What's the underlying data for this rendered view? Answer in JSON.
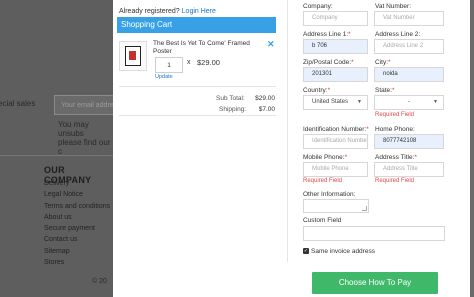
{
  "background": {
    "newsletter_placeholder": "Your email address",
    "special_sales": "ecial sales",
    "unsubscribe_line1": "You may unsubs",
    "unsubscribe_line2": "please find our c",
    "company_heading": "OUR COMPANY",
    "links": [
      "Delivery",
      "Legal Notice",
      "Terms and conditions",
      "About us",
      "Secure payment",
      "Contact us",
      "Sitemap",
      "Stores"
    ],
    "copyright": "© 20"
  },
  "cart": {
    "already_registered": "Already registered?",
    "login_link": "Login Here",
    "heading": "Shopping Cart",
    "item": {
      "name": "The Best Is Yet To Come' Framed Poster",
      "quantity": "1",
      "times": "x",
      "price": "$29.00",
      "update_label": "Update",
      "remove_icon": "close-icon"
    },
    "subtotal_label": "Sub Total:",
    "subtotal_value": "$29.00",
    "shipping_label": "Shipping:",
    "shipping_value": "$7.00"
  },
  "form": {
    "company": {
      "label": "Company:",
      "placeholder": "Company"
    },
    "vat": {
      "label": "Vat Number:",
      "placeholder": "Vat Number"
    },
    "address1": {
      "label": "Address Line 1:",
      "value": "b 706"
    },
    "address2": {
      "label": "Address Line 2:",
      "placeholder": "Address Line 2"
    },
    "zip": {
      "label": "Zip/Postal Code:",
      "value": "201301"
    },
    "city": {
      "label": "City:",
      "value": "noida"
    },
    "country": {
      "label": "Country:",
      "value": "United States"
    },
    "state": {
      "label": "State:",
      "value": "-",
      "error": "Required Field"
    },
    "id_number": {
      "label": "Identification Number:",
      "placeholder": "Identification Number"
    },
    "home_phone": {
      "label": "Home Phone:",
      "value": "8077742108"
    },
    "mobile_phone": {
      "label": "Mobile Phone:",
      "placeholder": "Mobile Phone",
      "error": "Required Field"
    },
    "address_title": {
      "label": "Address Title:",
      "placeholder": "Address Title",
      "error": "Required Field"
    },
    "other_info": {
      "label": "Other Information:"
    },
    "custom_field": {
      "label": "Custom Field"
    },
    "same_invoice": {
      "label": "Same invoice address",
      "checked": true
    },
    "submit_label": "Choose How To Pay"
  },
  "colors": {
    "accent": "#38a1e6",
    "submit": "#3fb86a",
    "error": "#e04848",
    "overlay": "#5e5e5e"
  }
}
